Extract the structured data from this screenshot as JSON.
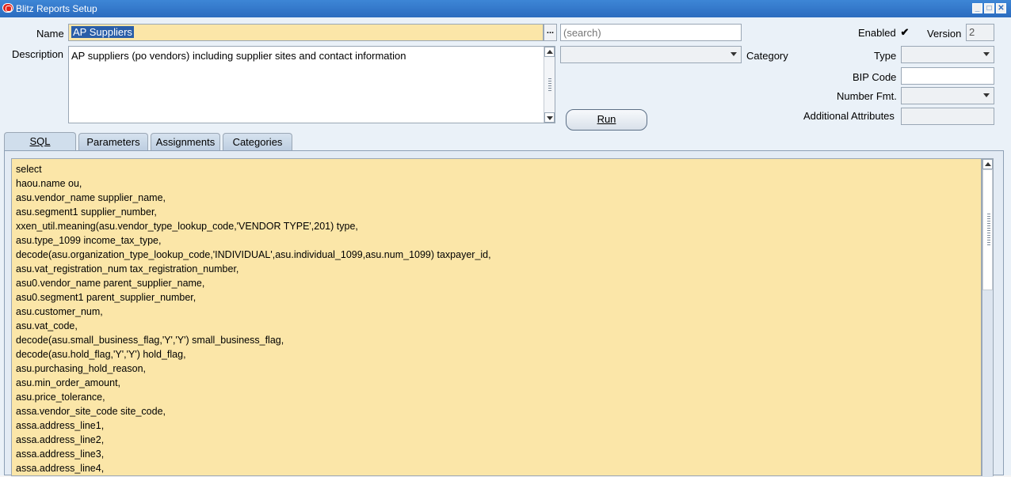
{
  "window": {
    "title": "Blitz Reports Setup"
  },
  "form": {
    "name_label": "Name",
    "name_value": "AP Suppliers",
    "lov_label": "...",
    "search_placeholder": "(search)",
    "description_label": "Description",
    "description_value": "AP suppliers (po vendors) including supplier sites and contact information",
    "category_label": "Category",
    "enabled_label": "Enabled",
    "enabled_checked": "✔",
    "version_label": "Version",
    "version_value": "2",
    "type_label": "Type",
    "bip_code_label": "BIP Code",
    "number_fmt_label": "Number Fmt.",
    "additional_attributes_label": "Additional Attributes",
    "run_label": "Run"
  },
  "tabs": [
    {
      "label": "SQL",
      "active": true
    },
    {
      "label": "Parameters",
      "active": false
    },
    {
      "label": "Assignments",
      "active": false
    },
    {
      "label": "Categories",
      "active": false
    }
  ],
  "sql_lines": [
    "select",
    "haou.name ou,",
    "asu.vendor_name supplier_name,",
    "asu.segment1 supplier_number,",
    "xxen_util.meaning(asu.vendor_type_lookup_code,'VENDOR TYPE',201) type,",
    "asu.type_1099 income_tax_type,",
    "decode(asu.organization_type_lookup_code,'INDIVIDUAL',asu.individual_1099,asu.num_1099) taxpayer_id,",
    "asu.vat_registration_num tax_registration_number,",
    "asu0.vendor_name parent_supplier_name,",
    "asu0.segment1 parent_supplier_number,",
    "asu.customer_num,",
    "asu.vat_code,",
    "decode(asu.small_business_flag,'Y','Y') small_business_flag,",
    "decode(asu.hold_flag,'Y','Y') hold_flag,",
    "asu.purchasing_hold_reason,",
    "asu.min_order_amount,",
    "asu.price_tolerance,",
    "assa.vendor_site_code site_code,",
    "assa.address_line1,",
    "assa.address_line2,",
    "assa.address_line3,",
    "assa.address_line4,"
  ]
}
